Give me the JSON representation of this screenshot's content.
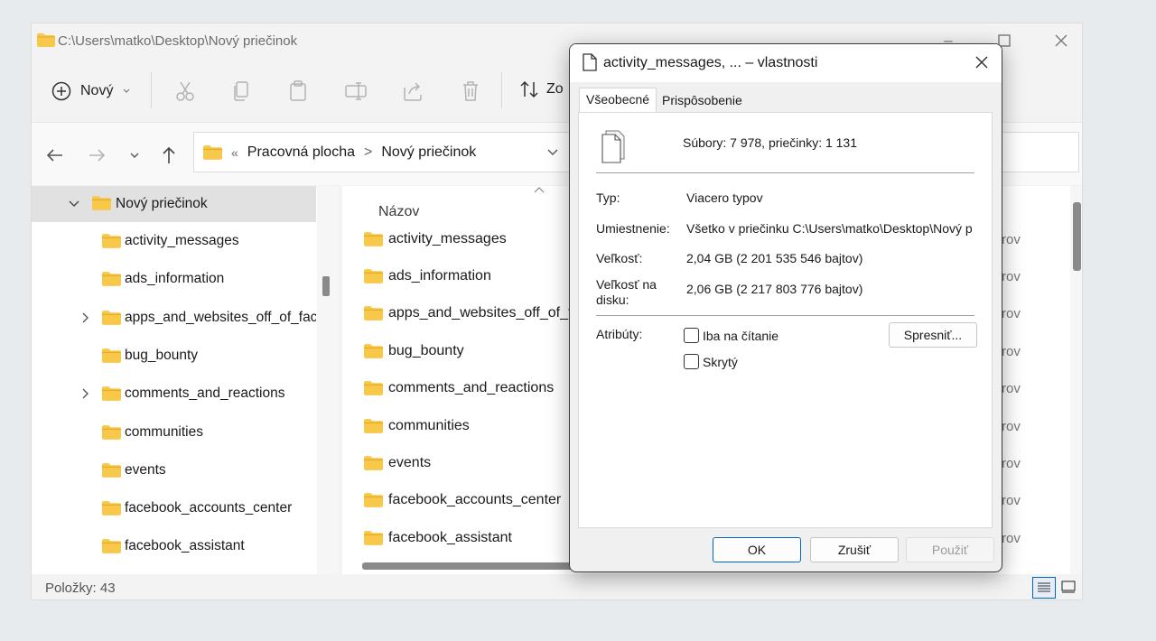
{
  "explorer": {
    "title": "C:\\Users\\matko\\Desktop\\Nový priečinok",
    "toolbar": {
      "new_label": "Nový",
      "sort_label": "Zo"
    },
    "breadcrumb": {
      "sep_prefix": "«",
      "part1": "Pracovná plocha",
      "sep": ">",
      "part2": "Nový priečinok"
    },
    "nav_pane": {
      "selected": "Nový priečinok",
      "items": [
        {
          "label": "activity_messages"
        },
        {
          "label": "ads_information"
        },
        {
          "label": "apps_and_websites_off_of_face"
        },
        {
          "label": "bug_bounty"
        },
        {
          "label": "comments_and_reactions"
        },
        {
          "label": "communities"
        },
        {
          "label": "events"
        },
        {
          "label": "facebook_accounts_center"
        },
        {
          "label": "facebook_assistant"
        }
      ]
    },
    "content": {
      "column_name": "Názov",
      "files": [
        {
          "name": "activity_messages",
          "extra": "rov"
        },
        {
          "name": "ads_information",
          "extra": "rov"
        },
        {
          "name": "apps_and_websites_off_of_fac",
          "extra": "rov"
        },
        {
          "name": "bug_bounty",
          "extra": "rov"
        },
        {
          "name": "comments_and_reactions",
          "extra": "rov"
        },
        {
          "name": "communities",
          "extra": "rov"
        },
        {
          "name": "events",
          "extra": "rov"
        },
        {
          "name": "facebook_accounts_center",
          "extra": "rov"
        },
        {
          "name": "facebook_assistant",
          "extra": "rov"
        }
      ]
    },
    "status": {
      "count": "Položky: 43"
    }
  },
  "dialog": {
    "title": "activity_messages, ... – vlastnosti",
    "tabs": [
      {
        "label": "Všeobecné"
      },
      {
        "label": "Prispôsobenie"
      }
    ],
    "summary": "Súbory: 7 978, priečinky: 1 131",
    "type_label": "Typ:",
    "type_value": "Viacero typov",
    "location_label": "Umiestnenie:",
    "location_value": "Všetko v priečinku C:\\Users\\matko\\Desktop\\Nový p",
    "size_label": "Veľkosť:",
    "size_value": "2,04 GB (2 201 535 546 bajtov)",
    "disk_label_1": "Veľkosť na",
    "disk_label_2": "disku:",
    "disk_value": "2,06 GB (2 217 803 776 bajtov)",
    "attrs_label": "Atribúty:",
    "readonly_label": "Iba na čítanie",
    "hidden_label": "Skrytý",
    "advanced_label": "Spresniť...",
    "ok_label": "OK",
    "cancel_label": "Zrušiť",
    "apply_label": "Použiť"
  },
  "colors": {
    "folder": "#f8c84a",
    "folder_dark": "#e8a91d",
    "accent": "#0067c0"
  }
}
